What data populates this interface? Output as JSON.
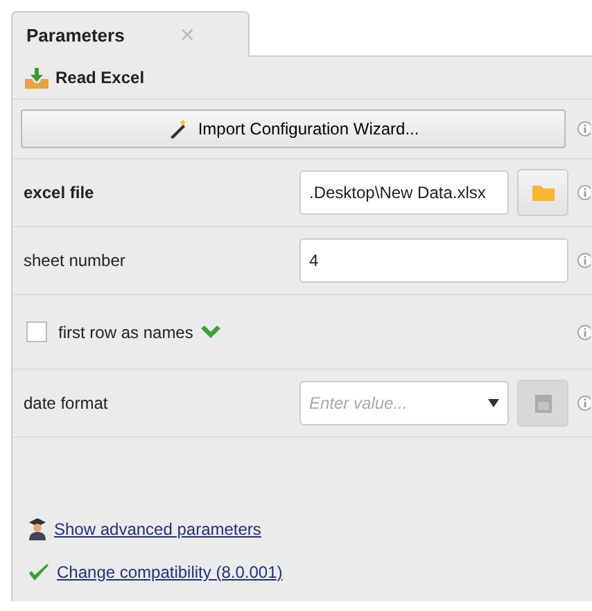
{
  "tab": {
    "label": "Parameters",
    "close": "×",
    "selected": true
  },
  "operator": {
    "title": "Read Excel"
  },
  "wizard_button": {
    "label": "Import Configuration Wizard..."
  },
  "parameters": [
    {
      "kind": "file",
      "label": "excel file",
      "value": ".Desktop\\New Data.xlsx",
      "bold": true
    },
    {
      "kind": "text",
      "label": "sheet number",
      "value": "4",
      "bold": false
    },
    {
      "kind": "checkbox",
      "label": "first row as names",
      "checked": false,
      "bold": false
    },
    {
      "kind": "combo",
      "label": "date format",
      "placeholder": "Enter value...",
      "bold": false
    }
  ],
  "links": [
    {
      "kind": "advanced",
      "label": "Show advanced parameters"
    },
    {
      "kind": "compat",
      "label": "Change compatibility (8.0.001)"
    }
  ]
}
